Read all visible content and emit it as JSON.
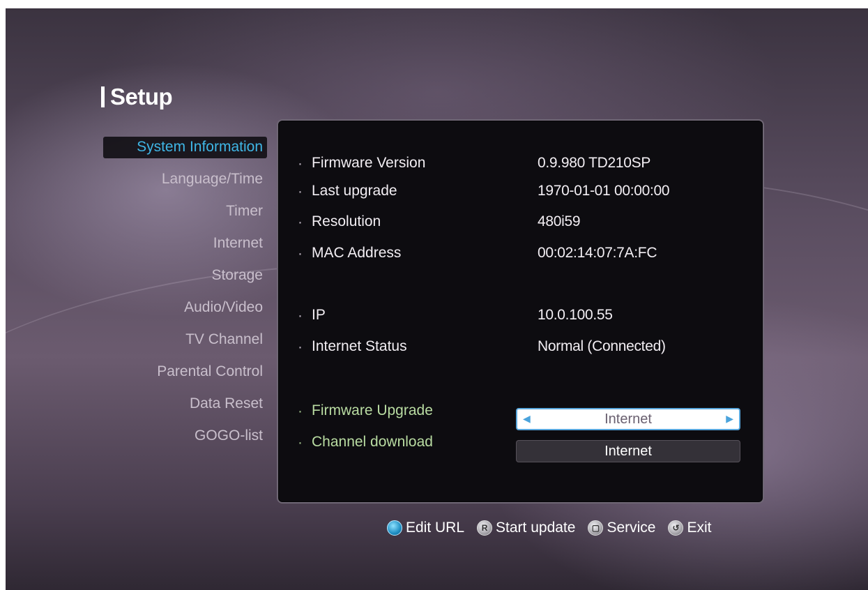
{
  "page": {
    "title": "Setup"
  },
  "menu": {
    "items": [
      {
        "label": "System Information",
        "active": true
      },
      {
        "label": "Language/Time",
        "active": false
      },
      {
        "label": "Timer",
        "active": false
      },
      {
        "label": "Internet",
        "active": false
      },
      {
        "label": "Storage",
        "active": false
      },
      {
        "label": "Audio/Video",
        "active": false
      },
      {
        "label": "TV Channel",
        "active": false
      },
      {
        "label": "Parental Control",
        "active": false
      },
      {
        "label": "Data Reset",
        "active": false
      },
      {
        "label": "GOGO-list",
        "active": false
      }
    ]
  },
  "info": {
    "firmware_version": {
      "label": "Firmware Version",
      "value": "0.9.980 TD210SP"
    },
    "last_upgrade": {
      "label": "Last upgrade",
      "value": "1970-01-01 00:00:00"
    },
    "resolution": {
      "label": "Resolution",
      "value": "480i59"
    },
    "mac_address": {
      "label": "MAC Address",
      "value": "00:02:14:07:7A:FC"
    },
    "ip": {
      "label": "IP",
      "value": "10.0.100.55"
    },
    "internet_status": {
      "label": "Internet Status",
      "value": "Normal (Connected)"
    }
  },
  "actions": {
    "firmware_upgrade": {
      "label": "Firmware Upgrade",
      "value": "Internet"
    },
    "channel_download": {
      "label": "Channel download",
      "value": "Internet"
    }
  },
  "footer": {
    "edit_url": "Edit URL",
    "start_update_key": "R",
    "start_update": "Start update",
    "service": "Service",
    "exit": "Exit"
  },
  "colors": {
    "accent": "#3fb6e6",
    "panel_bg": "#0d0c10",
    "selected_field_border": "#59a8de"
  },
  "icons": {
    "left_arrow": "triangle-left-icon",
    "right_arrow": "triangle-right-icon",
    "edit_url_key": "blue-button-icon",
    "start_update_key": "r-button-icon",
    "service_key": "square-button-icon",
    "exit_key": "back-button-icon"
  }
}
